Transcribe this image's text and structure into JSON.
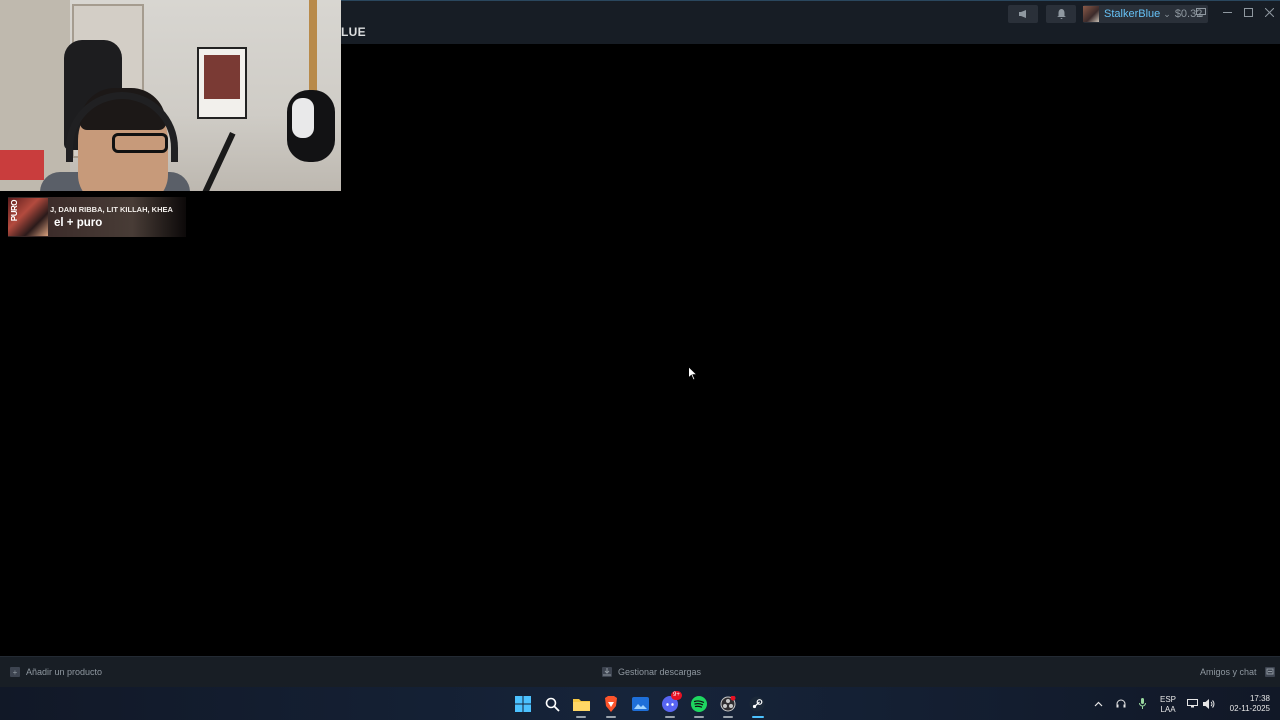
{
  "steam": {
    "nav_label": "LUE",
    "account_name": "StalkerBlue",
    "account_balance": "$0.32",
    "account_chevron": "⌄",
    "announcements_icon": "megaphone-icon",
    "notifications_icon": "bell-icon"
  },
  "music_overlay": {
    "artists": "J, DANI RIBBA, LIT KILLAH, KHEA",
    "track": "el + puro",
    "album_tag": "PURO"
  },
  "statusbar": {
    "add_product": "Añadir un producto",
    "downloads": "Gestionar descargas",
    "friends": "Amigos y chat"
  },
  "taskbar": {
    "apps": [
      "start",
      "search",
      "file-explorer",
      "brave",
      "photos",
      "discord",
      "spotify",
      "obs",
      "steam"
    ],
    "discord_badge": "9+",
    "lang_line1": "ESP",
    "lang_line2": "LAA",
    "time": "17:38",
    "date": "02-11-2025"
  },
  "colors": {
    "steam_blue": "#66c0f4",
    "titlebar": "#171d25",
    "statusbar": "#181e25"
  }
}
